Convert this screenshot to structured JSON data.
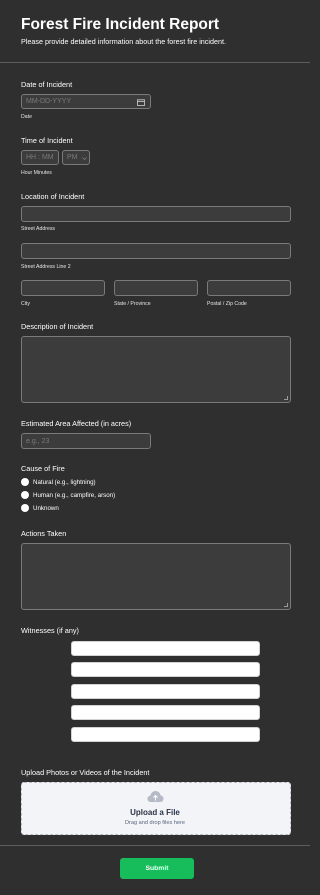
{
  "header": {
    "title": "Forest Fire Incident Report",
    "subtitle": "Please provide detailed information about the forest fire incident."
  },
  "date": {
    "label": "Date of Incident",
    "placeholder": "MM-DD-YYYY",
    "sublabel": "Date",
    "icon": "calendar-icon"
  },
  "time": {
    "label": "Time of Incident",
    "placeholder": "HH : MM",
    "ampm": "PM",
    "sublabel": "Hour Minutes",
    "icon": "chevron-down-icon"
  },
  "location": {
    "label": "Location of Incident",
    "street_sublabel": "Street Address",
    "street2_sublabel": "Street Address Line 2",
    "city_sublabel": "City",
    "state_sublabel": "State / Province",
    "postal_sublabel": "Postal / Zip Code"
  },
  "description": {
    "label": "Description of Incident"
  },
  "area": {
    "label": "Estimated Area Affected (in acres)",
    "placeholder": "e.g., 23"
  },
  "cause": {
    "label": "Cause of Fire",
    "options": [
      "Natural (e.g., lightning)",
      "Human (e.g., campfire, arson)",
      "Unknown"
    ]
  },
  "actions": {
    "label": "Actions Taken"
  },
  "witnesses": {
    "label": "Witnesses (if any)",
    "count": 5
  },
  "upload": {
    "label": "Upload Photos or Videos of the Incident",
    "title": "Upload a File",
    "subtitle": "Drag and drop files here",
    "icon": "cloud-upload-icon"
  },
  "submit": {
    "label": "Submit"
  },
  "colors": {
    "background": "#2f2f2f",
    "field": "#3c3c3c",
    "submit": "#18bd5b",
    "upload_bg": "#f3f4f7"
  }
}
